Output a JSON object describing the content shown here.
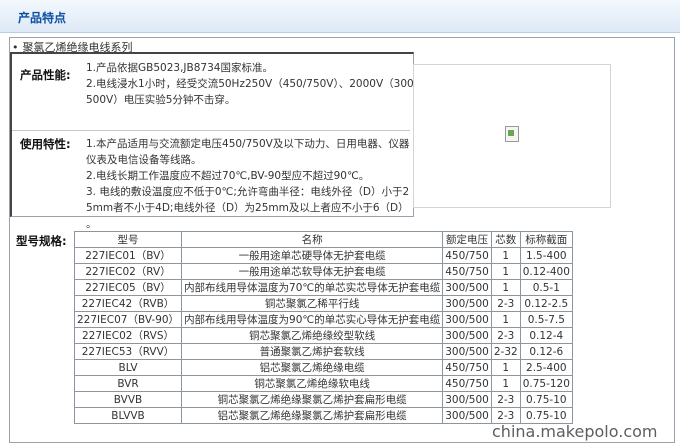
{
  "header": {
    "title": "产品特点"
  },
  "series": {
    "bullet": "•",
    "title": "聚氯乙烯绝缘电线系列"
  },
  "performance": {
    "label": "产品性能:",
    "lines": [
      "1.产品依据GB5023,JB8734国家标准。",
      "2.电线浸水1小时，经受交流50Hz250V（450/750V）、2000V（300/",
      "500V）电压实验5分钟不击穿。"
    ]
  },
  "usage": {
    "label": "使用特性:",
    "lines": [
      "1.本产品适用与交流额定电压450/750V及以下动力、日用电器、仪器",
      "仪表及电信设备等线路。",
      "2.电线长期工作温度应不超过70℃,BV-90型应不超过90℃。",
      "3. 电线的敷设温度应不低于0℃;允许弯曲半径：电线外径（D）小于2",
      "5mm者不小于4D;电线外径（D）为25mm及以上者应不小于6（D）",
      "。"
    ]
  },
  "spec": {
    "label": "型号规格:",
    "headers": [
      "型号",
      "名称",
      "额定电压",
      "芯数",
      "标称截面"
    ],
    "rows": [
      [
        "227IEC01（BV）",
        "一般用途单芯硬导体无护套电缆",
        "450/750",
        "1",
        "1.5-400"
      ],
      [
        "227IEC02（RV）",
        "一般用途单芯软导体无护套电缆",
        "450/750",
        "1",
        "0.12-400"
      ],
      [
        "227IEC05（BV）",
        "内部布线用导体温度为70℃的单芯实芯导体无护套电缆",
        "300/500",
        "1",
        "0.5-1"
      ],
      [
        "227IEC42（RVB）",
        "铜芯聚氯乙稀平行线",
        "300/500",
        "2-3",
        "0.12-2.5"
      ],
      [
        "227IEC07（BV-90）",
        "内部布线用导体温度为90℃的单芯实心导体无护套电缆",
        "300/500",
        "1",
        "0.5-7.5"
      ],
      [
        "227IEC02（RVS）",
        "铜芯聚氯乙烯绝缘绞型软线",
        "300/500",
        "2-3",
        "0.12-4"
      ],
      [
        "227IEC53（RVV）",
        "普通聚氯乙烯护套软线",
        "300/500",
        "2-32",
        "0.12-6"
      ],
      [
        "BLV",
        "铝芯聚氯乙烯绝缘电缆",
        "450/750",
        "1",
        "2.5-400"
      ],
      [
        "BVR",
        "铜芯聚氯乙烯绝缘软电线",
        "450/750",
        "1",
        "0.75-120"
      ],
      [
        "BVVB",
        "铜芯聚氯乙烯绝缘聚氯乙烯护套扁形电缆",
        "300/500",
        "2-3",
        "0.75-10"
      ],
      [
        "BLVVB",
        "铝芯聚氯乙烯绝缘聚氯乙烯护套扁形电缆",
        "300/500",
        "2-3",
        "0.75-10"
      ]
    ]
  },
  "watermark": "china.makepolo.com"
}
